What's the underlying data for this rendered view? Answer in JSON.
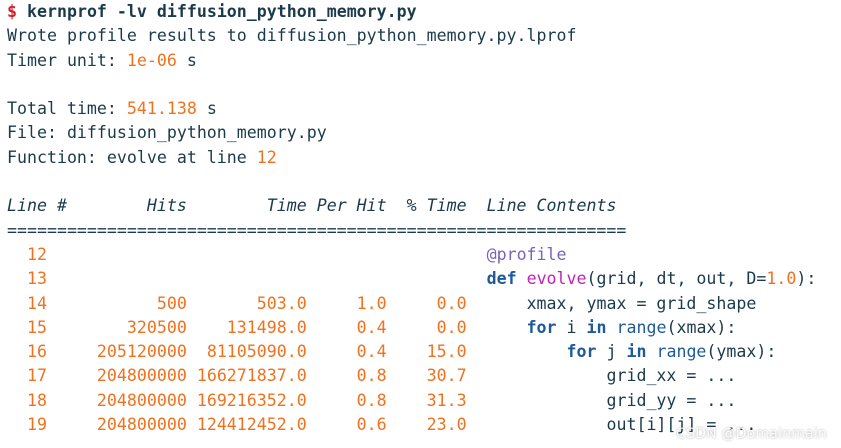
{
  "command": {
    "prompt": "$",
    "text": "kernprof -lv diffusion_python_memory.py"
  },
  "output": {
    "wrote_line": "Wrote profile results to diffusion_python_memory.py.lprof",
    "timer_label": "Timer unit: ",
    "timer_value": "1e-06",
    "timer_unit": " s",
    "total_label": "Total time: ",
    "total_value": "541.138",
    "total_unit": " s",
    "file_line": "File: diffusion_python_memory.py",
    "function_label": "Function: evolve at line ",
    "function_line": "12"
  },
  "table": {
    "headers": [
      "Line #",
      "Hits",
      "Time",
      "Per Hit",
      "% Time",
      "Line Contents"
    ],
    "rule": "==============================================================",
    "rows": [
      {
        "line": "12",
        "hits": "",
        "time": "",
        "per_hit": "",
        "pct": ""
      },
      {
        "line": "13",
        "hits": "",
        "time": "",
        "per_hit": "",
        "pct": ""
      },
      {
        "line": "14",
        "hits": "500",
        "time": "503.0",
        "per_hit": "1.0",
        "pct": "0.0"
      },
      {
        "line": "15",
        "hits": "320500",
        "time": "131498.0",
        "per_hit": "0.4",
        "pct": "0.0"
      },
      {
        "line": "16",
        "hits": "205120000",
        "time": "81105090.0",
        "per_hit": "0.4",
        "pct": "15.0"
      },
      {
        "line": "17",
        "hits": "204800000",
        "time": "166271837.0",
        "per_hit": "0.8",
        "pct": "30.7"
      },
      {
        "line": "18",
        "hits": "204800000",
        "time": "169216352.0",
        "per_hit": "0.8",
        "pct": "31.3"
      },
      {
        "line": "19",
        "hits": "204800000",
        "time": "124412452.0",
        "per_hit": "0.6",
        "pct": "23.0"
      }
    ],
    "code": {
      "r0": {
        "decorator": "@profile"
      },
      "r1": {
        "kw": "def",
        "fname": "evolve",
        "args_a": "(grid, dt, out, D=",
        "default": "1.0",
        "args_b": "):"
      },
      "r2": {
        "text": "xmax, ymax = grid_shape"
      },
      "r3": {
        "kw_for": "for",
        "var": " i ",
        "kw_in": "in",
        "builtin": "range",
        "rest": "(xmax):"
      },
      "r4": {
        "kw_for": "for",
        "var": " j ",
        "kw_in": "in",
        "builtin": "range",
        "rest": "(ymax):"
      },
      "r5": {
        "text": "grid_xx = ..."
      },
      "r6": {
        "text": "grid_yy = ..."
      },
      "r7": {
        "text": "out[i][j] = ..."
      }
    }
  },
  "watermark": "CSDN @Domainmain",
  "colors": {
    "number": "#f0721e",
    "text": "#1b3a4b",
    "prompt": "#d11e2a",
    "keyword": "#1e5a9a",
    "function": "#c022b8",
    "decorator": "#7a63b8"
  }
}
